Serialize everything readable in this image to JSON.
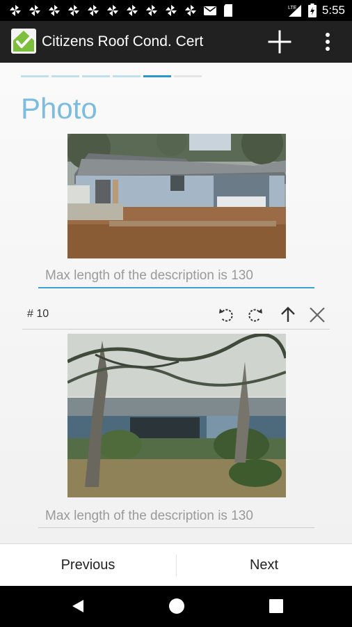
{
  "status_bar": {
    "time": "5:55",
    "network_label": "LTE",
    "icons": [
      "pinwheel-icon",
      "pinwheel-icon",
      "pinwheel-icon",
      "pinwheel-icon",
      "pinwheel-icon",
      "pinwheel-icon",
      "pinwheel-icon",
      "pinwheel-icon",
      "pinwheel-icon",
      "pinwheel-icon",
      "mail-icon",
      "sd-card-icon"
    ],
    "battery_icon": "battery-charging-icon",
    "signal_icon": "cell-signal-icon"
  },
  "app_bar": {
    "title": "Citizens Roof Cond. Cert",
    "logo_icon": "house-check-logo",
    "actions": [
      "add-icon",
      "more-vertical-icon"
    ]
  },
  "wizard": {
    "total_steps": 6,
    "current_step": 5
  },
  "page": {
    "title": "Photo"
  },
  "photos": [
    {
      "description_placeholder": "Max length of the description is 130",
      "description_value": "",
      "focused": true
    },
    {
      "number_label": "# 10",
      "description_placeholder": "Max length of the description is 130",
      "description_value": "",
      "focused": false,
      "tools": [
        "rotate-left-icon",
        "rotate-right-icon",
        "move-up-icon",
        "delete-icon"
      ]
    }
  ],
  "bottom_nav": {
    "previous_label": "Previous",
    "next_label": "Next"
  },
  "system_nav": [
    "back-icon",
    "home-icon",
    "recents-icon"
  ],
  "colors": {
    "app_bar": "#212121",
    "accent": "#3aa0d3",
    "title": "#7bbce0"
  }
}
